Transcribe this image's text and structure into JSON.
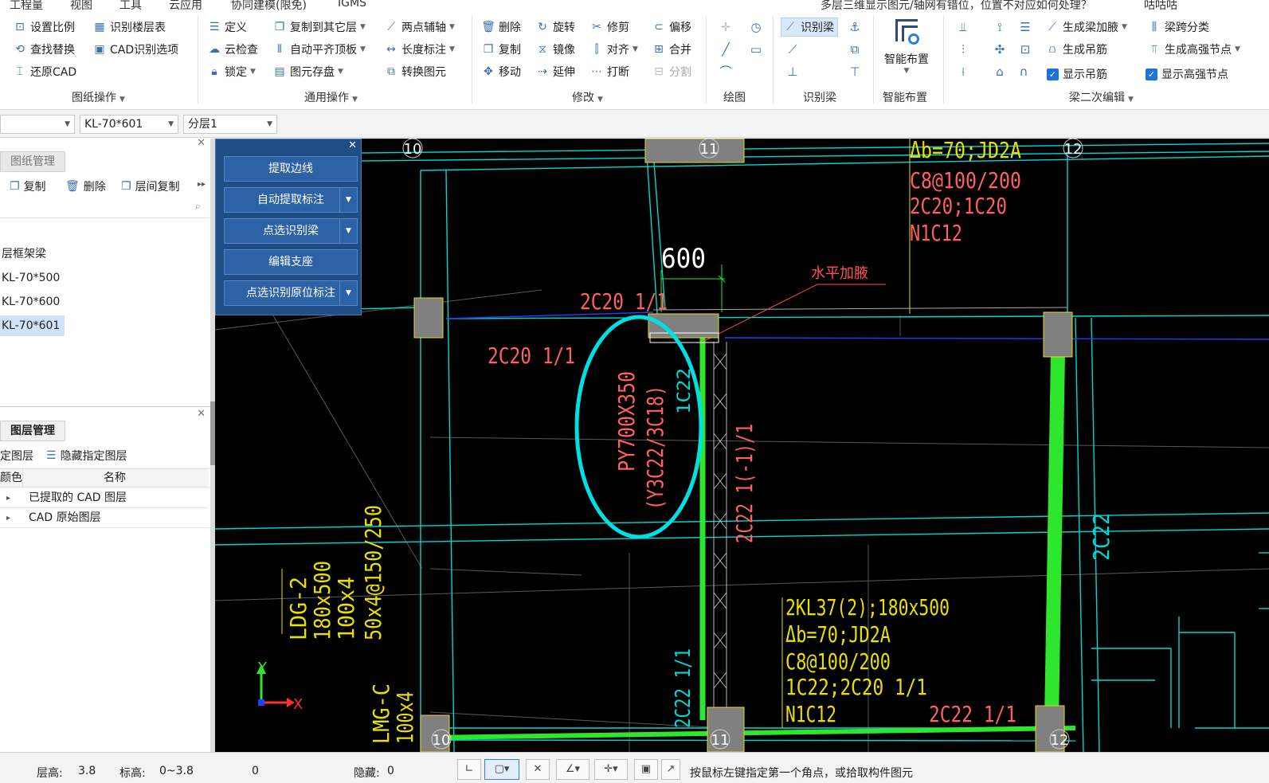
{
  "menubar": {
    "items": [
      "工程量",
      "视图",
      "工具",
      "云应用",
      "协同建模(限免)",
      "IGMS"
    ],
    "question": "多层三维显示图元/轴网有错位，位置不对应如何处理？",
    "user": "咕咕咕"
  },
  "ribbon": {
    "groups": {
      "drawing_ops": {
        "label": "图纸操作",
        "buttons": [
          "设置比例",
          "识别楼层表",
          "查找替换",
          "CAD识别选项",
          "还原CAD"
        ]
      },
      "general_ops": {
        "label": "通用操作",
        "buttons": [
          "定义",
          "复制到其它层",
          "两点辅轴",
          "云检查",
          "自动平齐顶板",
          "长度标注",
          "锁定",
          "图元存盘",
          "转换图元"
        ]
      },
      "modify": {
        "label": "修改",
        "buttons": [
          "删除",
          "旋转",
          "修剪",
          "偏移",
          "复制",
          "镜像",
          "对齐",
          "合并",
          "移动",
          "延伸",
          "打断",
          "分割"
        ]
      },
      "draw": {
        "label": "绘图"
      },
      "recognize_beam": {
        "label": "识别梁",
        "button": "识别梁"
      },
      "smart_layout": {
        "label": "智能布置",
        "button": "智能布置"
      },
      "beam_secondary": {
        "label": "梁二次编辑",
        "buttons": [
          "生成梁加腋",
          "梁跨分类",
          "生成吊筋",
          "生成高强节点"
        ],
        "checkboxes": [
          "显示吊筋",
          "显示高强节点"
        ]
      }
    }
  },
  "bar2": {
    "combo_beam": "KL-70*601",
    "combo_layer": "分层1"
  },
  "drawing_panel": {
    "tab": "图纸管理",
    "tools": [
      "复制",
      "删除",
      "层间复制"
    ],
    "tree_parent": "层框架梁",
    "tree_items": [
      "KL-70*500",
      "KL-70*600",
      "KL-70*601"
    ],
    "selected": "KL-70*601"
  },
  "layer_panel": {
    "tab": "图层管理",
    "tools": [
      "定图层",
      "隐藏指定图层"
    ],
    "col_color": "颜色",
    "col_name": "名称",
    "rows": [
      "已提取的 CAD 图层",
      "CAD 原始图层"
    ]
  },
  "float_panel": {
    "buttons": [
      "提取边线",
      "自动提取标注",
      "点选识别梁",
      "编辑支座",
      "点选识别原位标注"
    ]
  },
  "cad": {
    "axes": [
      "10",
      "11",
      "12",
      "10",
      "11",
      "12"
    ],
    "texts": {
      "top_right": [
        "Δb=70;JD2A",
        "C8@100/200",
        "2C20;1C20",
        "N1C12"
      ],
      "dim_600": "600",
      "haunch": "水平加腋",
      "beam_top1": "2C20 1/1",
      "beam_top2": "2C20 1/1",
      "circled_1": "PY700X350",
      "circled_2": "(Y3C22/3C18)",
      "v_1c22": "1C22",
      "v_2c22_mid": "2C22 1(-1)/1",
      "v_2c22_right": "2C22",
      "ldg": [
        "LDG-2",
        "180x500",
        "100x4",
        "50x4@150/250"
      ],
      "lmg": [
        "LMG-C",
        "100x4"
      ],
      "v_2c22_bottom": "2C22 1/1",
      "bottom_block": [
        "2KL37(2);180x500",
        "Δb=70;JD2A",
        "C8@100/200",
        "1C22;2C20 1/1",
        "N1C12"
      ],
      "bottom_2c22": "2C22 1/1",
      "axis_x": "X",
      "axis_y": "Y"
    },
    "colors": {
      "grid": "#00d7d7",
      "highlight": "#2ee62e",
      "annotation": "#ff6060",
      "label": "#e8e000",
      "circle": "#00e0e0"
    }
  },
  "status": {
    "floor_height_label": "层高:",
    "floor_height": "3.8",
    "elevation_label": "标高:",
    "elevation": "0~3.8",
    "count": "0",
    "hidden_label": "隐藏:",
    "hidden": "0",
    "hint": "按鼠标左键指定第一个角点，或拾取构件图元"
  }
}
